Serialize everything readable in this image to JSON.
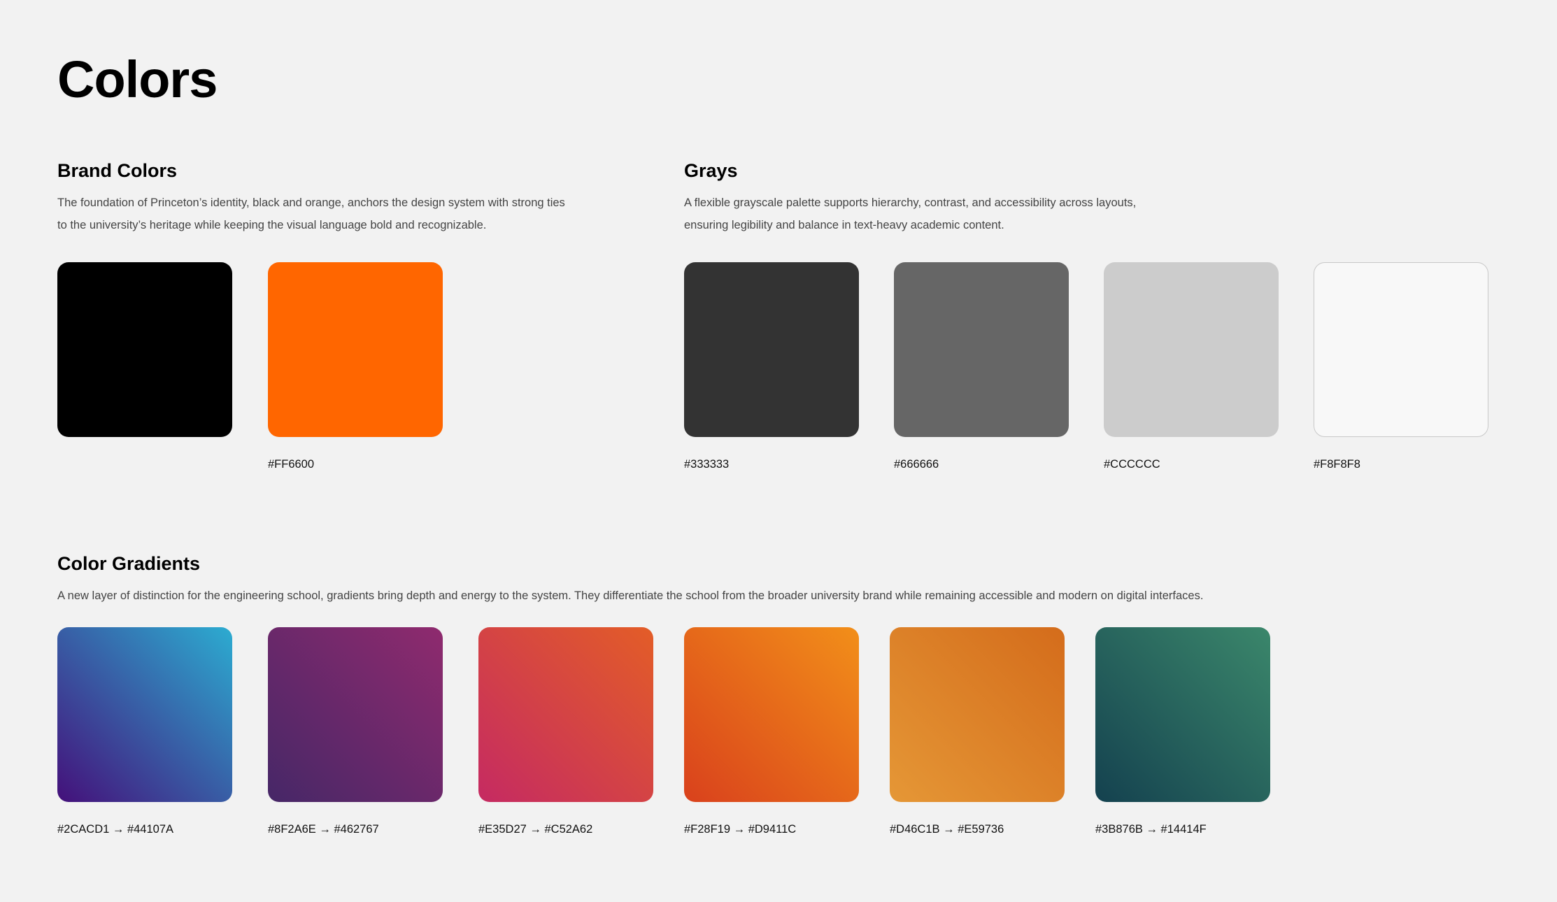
{
  "page": {
    "title": "Colors"
  },
  "brand": {
    "title": "Brand Colors",
    "description": "The foundation of Princeton’s identity, black and orange, anchors the design system with strong ties to the university’s heritage while keeping the visual language bold and recognizable.",
    "swatches": [
      {
        "color": "#000000",
        "label": ""
      },
      {
        "color": "#FF6600",
        "label": "#FF6600"
      }
    ]
  },
  "grays": {
    "title": "Grays",
    "description": "A flexible grayscale palette supports hierarchy, contrast, and accessibility across layouts, ensuring legibility and balance in text-heavy academic content.",
    "swatches": [
      {
        "color": "#333333",
        "label": "#333333"
      },
      {
        "color": "#666666",
        "label": "#666666"
      },
      {
        "color": "#CCCCCC",
        "label": "#CCCCCC"
      },
      {
        "color": "#F8F8F8",
        "label": "#F8F8F8"
      }
    ]
  },
  "gradients": {
    "title": "Color Gradients",
    "description": "A new layer of distinction for the engineering school, gradients bring depth and energy to the system. They differentiate the school from the broader university brand while remaining accessible and modern on digital interfaces.",
    "swatches": [
      {
        "from": "#2CACD1",
        "to": "#44107A",
        "label": "#2CACD1 → #44107A"
      },
      {
        "from": "#8F2A6E",
        "to": "#462767",
        "label": "#8F2A6E → #462767"
      },
      {
        "from": "#E35D27",
        "to": "#C52A62",
        "label": "#E35D27 → #C52A62"
      },
      {
        "from": "#F28F19",
        "to": "#D9411C",
        "label": "#F28F19 → #D9411C"
      },
      {
        "from": "#D46C1B",
        "to": "#E59736",
        "label": "#D46C1B → #E59736"
      },
      {
        "from": "#3B876B",
        "to": "#14414F",
        "label": "#3B876B → #14414F"
      }
    ]
  }
}
